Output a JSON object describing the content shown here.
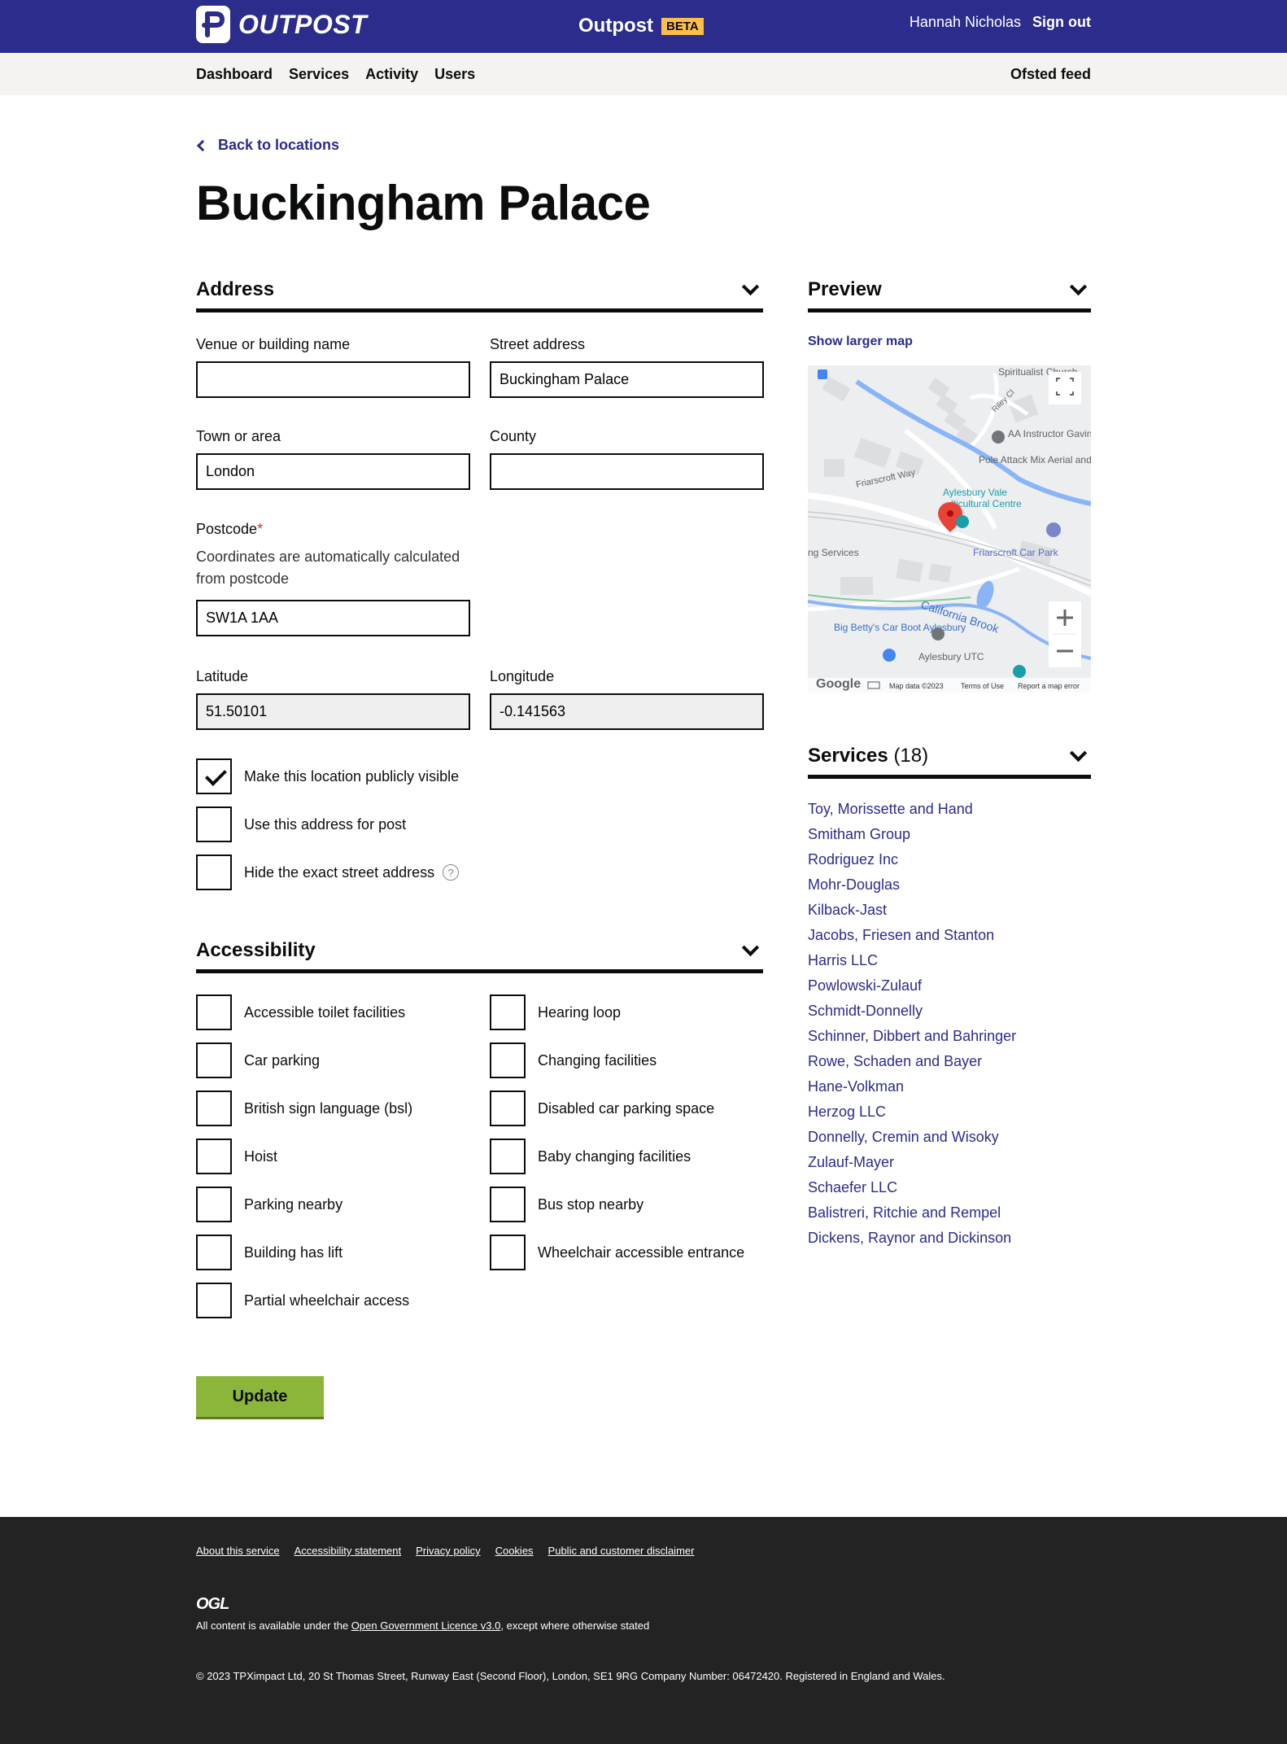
{
  "header": {
    "logo_text": "OUTPOST",
    "title": "Outpost",
    "beta": "BETA",
    "user": "Hannah Nicholas",
    "sign_out": "Sign out",
    "bg_color": "#2b2c8c"
  },
  "subnav": {
    "items": [
      "Dashboard",
      "Services",
      "Activity",
      "Users"
    ],
    "right": "Ofsted feed"
  },
  "back_link": "Back to locations",
  "page_title": "Buckingham Palace",
  "address": {
    "heading": "Address",
    "venue": {
      "label": "Venue or building name",
      "value": ""
    },
    "street": {
      "label": "Street address",
      "value": "Buckingham Palace"
    },
    "town": {
      "label": "Town or area",
      "value": "London"
    },
    "county": {
      "label": "County",
      "value": ""
    },
    "postcode": {
      "label": "Postcode",
      "required_mark": "*",
      "hint": "Coordinates are automatically calculated from postcode",
      "value": "SW1A 1AA"
    },
    "latitude": {
      "label": "Latitude",
      "value": "51.50101"
    },
    "longitude": {
      "label": "Longitude",
      "value": "-0.141563"
    },
    "checkboxes": [
      {
        "label": "Make this location publicly visible",
        "checked": true
      },
      {
        "label": "Use this address for post",
        "checked": false
      },
      {
        "label": "Hide the exact street address",
        "checked": false,
        "help": "?"
      }
    ]
  },
  "accessibility": {
    "heading": "Accessibility",
    "left": [
      "Accessible toilet facilities",
      "Car parking",
      "British sign language (bsl)",
      "Hoist",
      "Parking nearby",
      "Building has lift",
      "Partial wheelchair access"
    ],
    "right": [
      "Hearing loop",
      "Changing facilities",
      "Disabled car parking space",
      "Baby changing facilities",
      "Bus stop nearby",
      "Wheelchair accessible entrance"
    ]
  },
  "update_button": "Update",
  "preview": {
    "heading": "Preview",
    "show_larger_map": "Show larger map",
    "map_labels": {
      "church": "Spiritualist Church",
      "riley": "Riley Cl",
      "aa": "AA Instructor Gavin Talmer",
      "pole": "Pole Attack Mix Aerial and Pole Danc",
      "friarscroft_way": "Friarscroft Way",
      "aylesbury_vale": "Aylesbury Vale",
      "multicultural": "lticultural Centre",
      "services": "ng Services",
      "car_park": "Friarscroft Car Park",
      "brook": "California Brook",
      "big_betty": "Big Betty's Car Boot Aylesbury",
      "utc": "Aylesbury UTC",
      "google": "Google",
      "map_data": "Map data ©2023",
      "terms": "Terms of Use",
      "report": "Report a map error"
    }
  },
  "services": {
    "heading": "Services",
    "count": "(18)",
    "items": [
      "Toy, Morissette and Hand",
      "Smitham Group",
      "Rodriguez Inc",
      "Mohr-Douglas",
      "Kilback-Jast",
      "Jacobs, Friesen and Stanton",
      "Harris LLC",
      "Powlowski-Zulauf",
      "Schmidt-Donnelly",
      "Schinner, Dibbert and Bahringer",
      "Rowe, Schaden and Bayer",
      "Hane-Volkman",
      "Herzog LLC",
      "Donnelly, Cremin and Wisoky",
      "Zulauf-Mayer",
      "Schaefer LLC",
      "Balistreri, Ritchie and Rempel",
      "Dickens, Raynor and Dickinson"
    ]
  },
  "footer": {
    "links": [
      "About this service",
      "Accessibility statement",
      "Privacy policy",
      "Cookies",
      "Public and customer disclaimer"
    ],
    "ogl": "OGL",
    "licence_pre": "All content is available under the ",
    "licence_link": "Open Government Licence v3.0",
    "licence_post": ", except where otherwise stated",
    "copyright": "© 2023 TPXimpact Ltd, 20 St Thomas Street, Runway East (Second Floor), London, SE1 9RG Company Number: 06472420. Registered in England and Wales."
  }
}
